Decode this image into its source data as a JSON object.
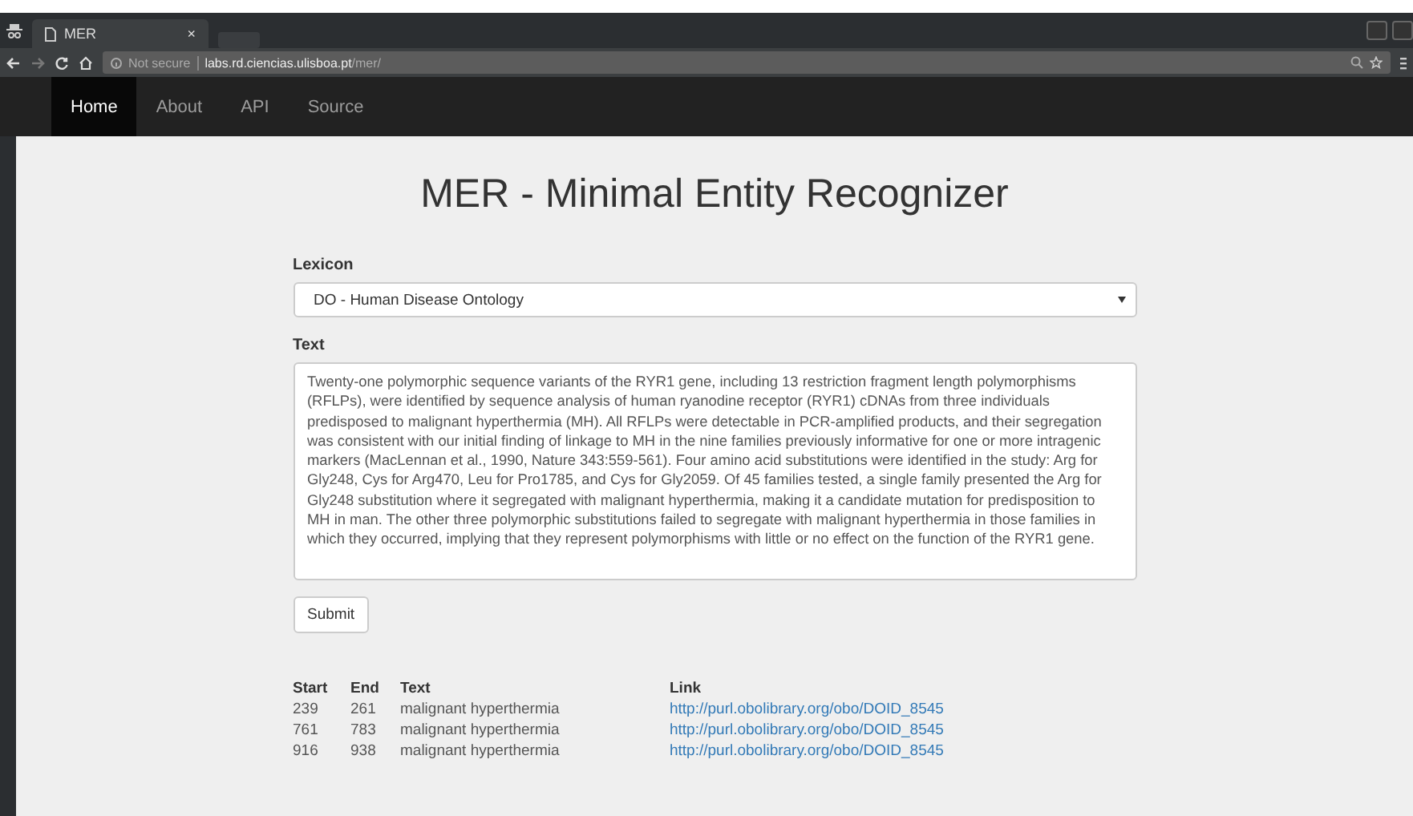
{
  "browser": {
    "tab_title": "MER",
    "tab_close": "×",
    "security": "Not secure",
    "host": "labs.rd.ciencias.ulisboa.pt",
    "path": "/mer/"
  },
  "nav": [
    {
      "label": "Home",
      "selected": true
    },
    {
      "label": "About",
      "selected": false
    },
    {
      "label": "API",
      "selected": false
    },
    {
      "label": "Source",
      "selected": false
    }
  ],
  "title": "MER - Minimal Entity Recognizer",
  "lexicon": {
    "label": "Lexicon",
    "value": "DO - Human Disease Ontology"
  },
  "text": {
    "label": "Text",
    "value": "Twenty-one polymorphic sequence variants of the RYR1 gene, including 13 restriction fragment length polymorphisms (RFLPs), were identified by sequence analysis of human ryanodine receptor (RYR1) cDNAs from three individuals predisposed to malignant hyperthermia (MH). All RFLPs were detectable in PCR-amplified products, and their segregation was consistent with our initial finding of linkage to MH in the nine families previously informative for one or more intragenic markers (MacLennan et al., 1990, Nature 343:559-561). Four amino acid substitutions were identified in the study: Arg for Gly248, Cys for Arg470, Leu for Pro1785, and Cys for Gly2059. Of 45 families tested, a single family presented the Arg for Gly248 substitution where it segregated with malignant hyperthermia, making it a candidate mutation for predisposition to MH in man. The other three polymorphic substitutions failed to segregate with malignant hyperthermia in those families in which they occurred, implying that they represent polymorphisms with little or no effect on the function of the RYR1 gene."
  },
  "submit": "Submit",
  "table": {
    "columns": [
      "Start",
      "End",
      "Text",
      "Link"
    ],
    "rows": [
      [
        "239",
        "261",
        "malignant hyperthermia",
        "http://purl.obolibrary.org/obo/DOID_8545"
      ],
      [
        "761",
        "783",
        "malignant hyperthermia",
        "http://purl.obolibrary.org/obo/DOID_8545"
      ],
      [
        "916",
        "938",
        "malignant hyperthermia",
        "http://purl.obolibrary.org/obo/DOID_8545"
      ]
    ]
  }
}
